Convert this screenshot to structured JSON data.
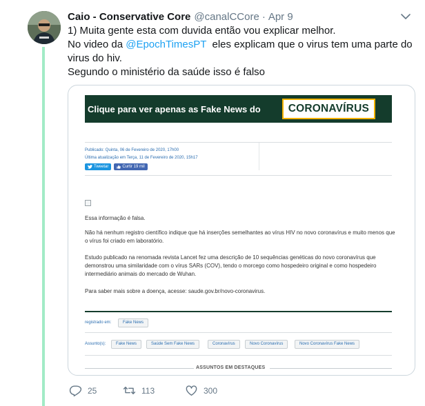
{
  "tweet": {
    "display_name": "Caio - Conservative Core",
    "handle": "@canalCCore",
    "separator": "·",
    "date": "Apr 9",
    "line1": "1) Muita gente esta com duvida então vou explicar melhor.",
    "line2_prefix": "No video da ",
    "mention": "@EpochTimesPT",
    "line2_suffix": "  eles explicam que o virus tem uma parte do virus do hiv.",
    "line3": "Segundo o ministério da saúde isso é falso"
  },
  "card": {
    "banner_text": "Clique para ver apenas as Fake News do",
    "banner_box_text": "CORONAVÍRUS",
    "published": "Publicado: Quinta, 06 de Fevereiro de 2020, 17h00",
    "updated": "Última atualização em Terça, 11 de Fevereiro de 2020, 15h17",
    "tweet_btn": "Tweetar",
    "like_btn": "Curtir 19 mil",
    "para1": "Essa informação é falsa.",
    "para2": "Não há nenhum registro científico indique que há inserções semelhantes ao vírus HIV no novo coronavírus e muito menos que o vírus foi criado em laboratório.",
    "para3": "Estudo publicado na renomada revista Lancet fez uma descrição de 10 sequências genéticas do novo coronavírus que demonstrou uma similaridade com o vírus SARs (COV), tendo o morcego como hospedeiro original e como hospedeiro intermediário animais do mercado de Wuhan.",
    "para4": "Para saber mais sobre a doença, acesse: saude.gov.br/novo-coronavirus.",
    "registrado_label": "registrado em:",
    "registrado_tag": "Fake News",
    "assuntos_label": "Assunto(s):",
    "assuntos": [
      "Fake News",
      "Saúde Sem Fake News",
      "Coronavírus",
      "Novo Coronavírus",
      "Novo Coronavírus Fake News"
    ],
    "destaques": "ASSUNTOS EM DESTAQUES"
  },
  "actions": {
    "replies": "25",
    "retweets": "113",
    "likes": "300"
  },
  "colors": {
    "thread_line": "#a2ebc6",
    "mention": "#1da1f2",
    "banner_bg": "#143c2c",
    "banner_box_border": "#f5b300"
  },
  "icons": [
    "reply-icon",
    "retweet-icon",
    "like-icon",
    "chevron-down-icon",
    "twitter-bird-icon",
    "facebook-like-icon"
  ]
}
